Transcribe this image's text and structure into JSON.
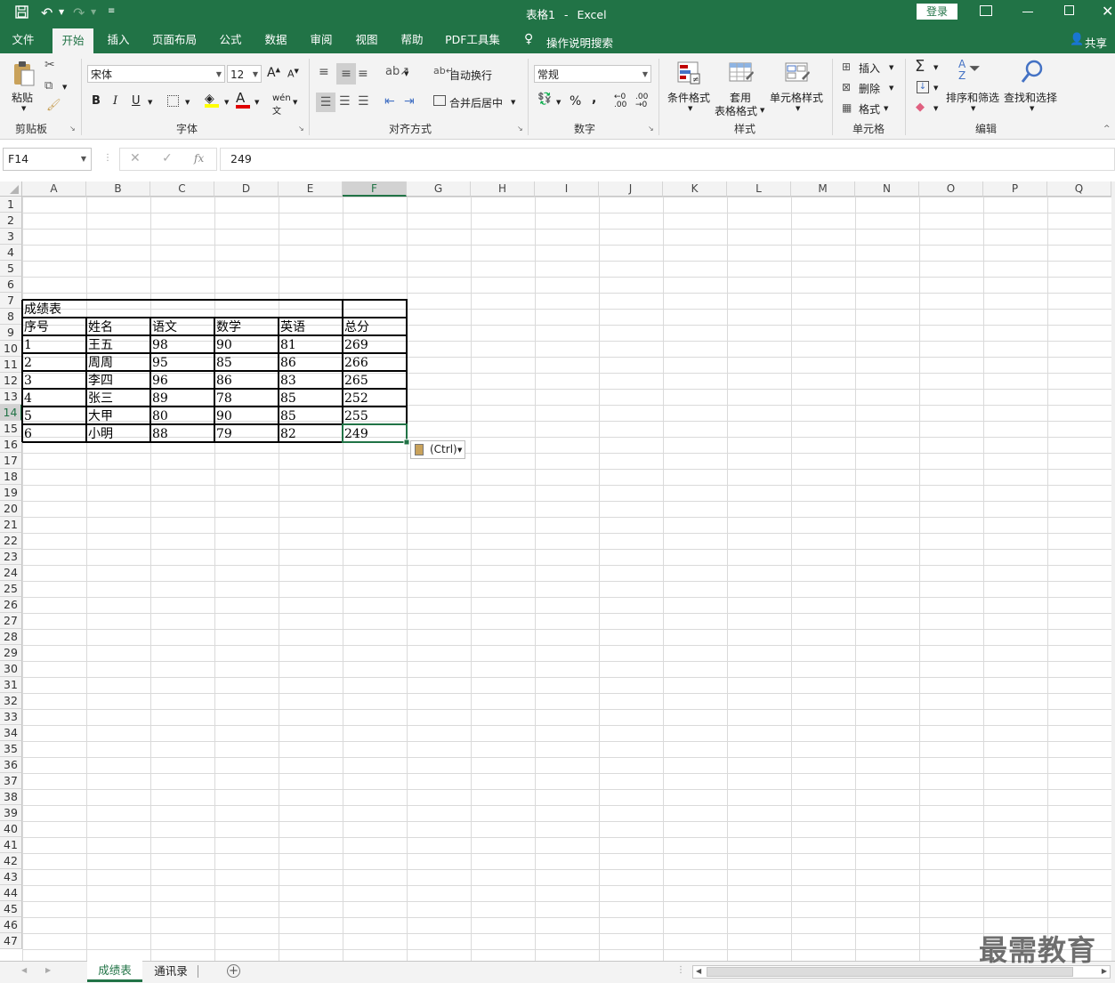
{
  "window": {
    "doc_title": "表格1",
    "separator": "-",
    "app_name": "Excel",
    "login_button": "登录",
    "share": "共享"
  },
  "tabs": [
    "文件",
    "开始",
    "插入",
    "页面布局",
    "公式",
    "数据",
    "审阅",
    "视图",
    "帮助",
    "PDF工具集"
  ],
  "tell_me": "操作说明搜索",
  "ribbon": {
    "clipboard": {
      "paste": "粘贴",
      "label": "剪贴板"
    },
    "font": {
      "name": "宋体",
      "size": "12",
      "label": "字体",
      "bold": "B",
      "italic": "I",
      "underline": "U"
    },
    "alignment": {
      "wrap": "自动换行",
      "merge": "合并后居中",
      "label": "对齐方式"
    },
    "number": {
      "format": "常规",
      "percent": "%",
      "comma": ",",
      "label": "数字"
    },
    "styles": {
      "cond": "条件格式",
      "table1": "套用",
      "table2": "表格格式",
      "cell_styles": "单元格样式",
      "label": "样式"
    },
    "cells": {
      "insert": "插入",
      "delete": "删除",
      "format": "格式",
      "label": "单元格"
    },
    "editing": {
      "sort": "排序和筛选",
      "find": "查找和选择",
      "label": "编辑"
    }
  },
  "formula_bar": {
    "name_box": "F14",
    "fx": "fx",
    "value": "249"
  },
  "columns": [
    "A",
    "B",
    "C",
    "D",
    "E",
    "F",
    "G",
    "H",
    "I",
    "J",
    "K",
    "L",
    "M",
    "N",
    "O",
    "P",
    "Q"
  ],
  "rows": [
    "1",
    "2",
    "3",
    "4",
    "5",
    "6",
    "7",
    "8",
    "9",
    "10",
    "11",
    "12",
    "13",
    "14",
    "15",
    "16",
    "17",
    "18",
    "19",
    "20",
    "21",
    "22",
    "23",
    "24",
    "25",
    "26",
    "27",
    "28",
    "29",
    "30",
    "31",
    "32",
    "33",
    "34",
    "35",
    "36",
    "37",
    "38",
    "39",
    "40",
    "41",
    "42",
    "43",
    "44",
    "45",
    "46",
    "47"
  ],
  "table": {
    "title": "成绩表",
    "headers": [
      "序号",
      "姓名",
      "语文",
      "数学",
      "英语",
      "总分"
    ],
    "data": [
      [
        "1",
        "王五",
        "98",
        "90",
        "81",
        "269"
      ],
      [
        "2",
        "周周",
        "95",
        "85",
        "86",
        "266"
      ],
      [
        "3",
        "李四",
        "96",
        "86",
        "83",
        "265"
      ],
      [
        "4",
        "张三",
        "89",
        "78",
        "85",
        "252"
      ],
      [
        "5",
        "大甲",
        "80",
        "90",
        "85",
        "255"
      ],
      [
        "6",
        "小明",
        "88",
        "79",
        "82",
        "249"
      ]
    ]
  },
  "paste_options": "(Ctrl)",
  "sheets": [
    "成绩表",
    "通讯录"
  ],
  "watermark": "最需教育",
  "colors": {
    "accent": "#217346"
  }
}
